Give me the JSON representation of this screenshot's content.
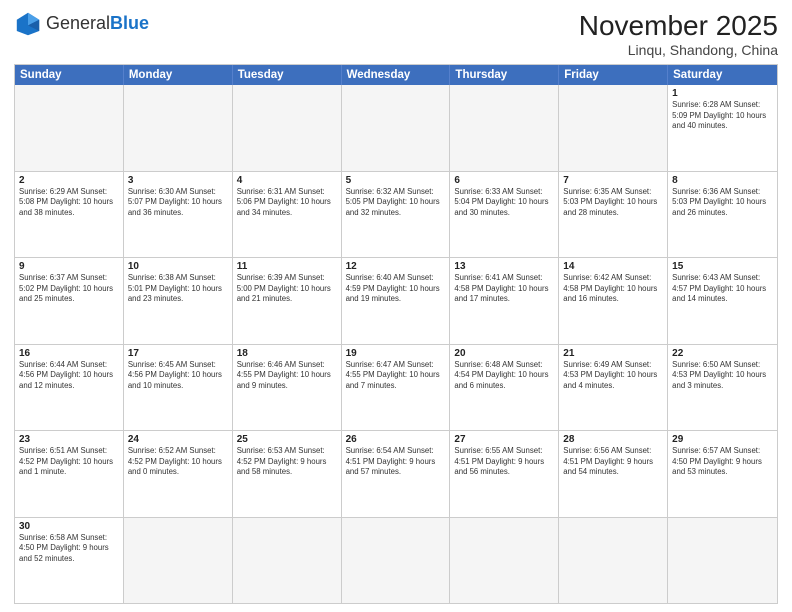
{
  "header": {
    "logo_general": "General",
    "logo_blue": "Blue",
    "month_year": "November 2025",
    "location": "Linqu, Shandong, China"
  },
  "weekdays": [
    "Sunday",
    "Monday",
    "Tuesday",
    "Wednesday",
    "Thursday",
    "Friday",
    "Saturday"
  ],
  "weeks": [
    [
      {
        "day": "",
        "info": ""
      },
      {
        "day": "",
        "info": ""
      },
      {
        "day": "",
        "info": ""
      },
      {
        "day": "",
        "info": ""
      },
      {
        "day": "",
        "info": ""
      },
      {
        "day": "",
        "info": ""
      },
      {
        "day": "1",
        "info": "Sunrise: 6:28 AM\nSunset: 5:09 PM\nDaylight: 10 hours and 40 minutes."
      }
    ],
    [
      {
        "day": "2",
        "info": "Sunrise: 6:29 AM\nSunset: 5:08 PM\nDaylight: 10 hours and 38 minutes."
      },
      {
        "day": "3",
        "info": "Sunrise: 6:30 AM\nSunset: 5:07 PM\nDaylight: 10 hours and 36 minutes."
      },
      {
        "day": "4",
        "info": "Sunrise: 6:31 AM\nSunset: 5:06 PM\nDaylight: 10 hours and 34 minutes."
      },
      {
        "day": "5",
        "info": "Sunrise: 6:32 AM\nSunset: 5:05 PM\nDaylight: 10 hours and 32 minutes."
      },
      {
        "day": "6",
        "info": "Sunrise: 6:33 AM\nSunset: 5:04 PM\nDaylight: 10 hours and 30 minutes."
      },
      {
        "day": "7",
        "info": "Sunrise: 6:35 AM\nSunset: 5:03 PM\nDaylight: 10 hours and 28 minutes."
      },
      {
        "day": "8",
        "info": "Sunrise: 6:36 AM\nSunset: 5:03 PM\nDaylight: 10 hours and 26 minutes."
      }
    ],
    [
      {
        "day": "9",
        "info": "Sunrise: 6:37 AM\nSunset: 5:02 PM\nDaylight: 10 hours and 25 minutes."
      },
      {
        "day": "10",
        "info": "Sunrise: 6:38 AM\nSunset: 5:01 PM\nDaylight: 10 hours and 23 minutes."
      },
      {
        "day": "11",
        "info": "Sunrise: 6:39 AM\nSunset: 5:00 PM\nDaylight: 10 hours and 21 minutes."
      },
      {
        "day": "12",
        "info": "Sunrise: 6:40 AM\nSunset: 4:59 PM\nDaylight: 10 hours and 19 minutes."
      },
      {
        "day": "13",
        "info": "Sunrise: 6:41 AM\nSunset: 4:58 PM\nDaylight: 10 hours and 17 minutes."
      },
      {
        "day": "14",
        "info": "Sunrise: 6:42 AM\nSunset: 4:58 PM\nDaylight: 10 hours and 16 minutes."
      },
      {
        "day": "15",
        "info": "Sunrise: 6:43 AM\nSunset: 4:57 PM\nDaylight: 10 hours and 14 minutes."
      }
    ],
    [
      {
        "day": "16",
        "info": "Sunrise: 6:44 AM\nSunset: 4:56 PM\nDaylight: 10 hours and 12 minutes."
      },
      {
        "day": "17",
        "info": "Sunrise: 6:45 AM\nSunset: 4:56 PM\nDaylight: 10 hours and 10 minutes."
      },
      {
        "day": "18",
        "info": "Sunrise: 6:46 AM\nSunset: 4:55 PM\nDaylight: 10 hours and 9 minutes."
      },
      {
        "day": "19",
        "info": "Sunrise: 6:47 AM\nSunset: 4:55 PM\nDaylight: 10 hours and 7 minutes."
      },
      {
        "day": "20",
        "info": "Sunrise: 6:48 AM\nSunset: 4:54 PM\nDaylight: 10 hours and 6 minutes."
      },
      {
        "day": "21",
        "info": "Sunrise: 6:49 AM\nSunset: 4:53 PM\nDaylight: 10 hours and 4 minutes."
      },
      {
        "day": "22",
        "info": "Sunrise: 6:50 AM\nSunset: 4:53 PM\nDaylight: 10 hours and 3 minutes."
      }
    ],
    [
      {
        "day": "23",
        "info": "Sunrise: 6:51 AM\nSunset: 4:52 PM\nDaylight: 10 hours and 1 minute."
      },
      {
        "day": "24",
        "info": "Sunrise: 6:52 AM\nSunset: 4:52 PM\nDaylight: 10 hours and 0 minutes."
      },
      {
        "day": "25",
        "info": "Sunrise: 6:53 AM\nSunset: 4:52 PM\nDaylight: 9 hours and 58 minutes."
      },
      {
        "day": "26",
        "info": "Sunrise: 6:54 AM\nSunset: 4:51 PM\nDaylight: 9 hours and 57 minutes."
      },
      {
        "day": "27",
        "info": "Sunrise: 6:55 AM\nSunset: 4:51 PM\nDaylight: 9 hours and 56 minutes."
      },
      {
        "day": "28",
        "info": "Sunrise: 6:56 AM\nSunset: 4:51 PM\nDaylight: 9 hours and 54 minutes."
      },
      {
        "day": "29",
        "info": "Sunrise: 6:57 AM\nSunset: 4:50 PM\nDaylight: 9 hours and 53 minutes."
      }
    ],
    [
      {
        "day": "30",
        "info": "Sunrise: 6:58 AM\nSunset: 4:50 PM\nDaylight: 9 hours and 52 minutes."
      },
      {
        "day": "",
        "info": ""
      },
      {
        "day": "",
        "info": ""
      },
      {
        "day": "",
        "info": ""
      },
      {
        "day": "",
        "info": ""
      },
      {
        "day": "",
        "info": ""
      },
      {
        "day": "",
        "info": ""
      }
    ]
  ]
}
